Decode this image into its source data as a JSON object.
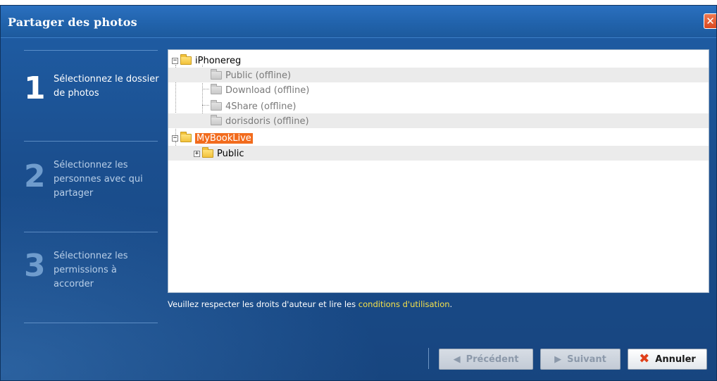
{
  "window": {
    "title": "Partager des photos"
  },
  "steps": [
    {
      "number": "1",
      "text": "Sélectionnez le dossier de photos",
      "active": true
    },
    {
      "number": "2",
      "text": "Sélectionnez les personnes avec qui partager",
      "active": false
    },
    {
      "number": "3",
      "text": "Sélectionnez les permissions à accorder",
      "active": false
    }
  ],
  "tree": {
    "items": [
      {
        "label": "iPhonereg",
        "expander": "−"
      },
      {
        "label": "Public (offline)"
      },
      {
        "label": "Download (offline)"
      },
      {
        "label": "4Share (offline)"
      },
      {
        "label": "dorisdoris (offline)"
      },
      {
        "label": "MyBookLive",
        "expander": "−",
        "selected": true
      },
      {
        "label": "Public",
        "expander": "+"
      }
    ]
  },
  "footer": {
    "notice_prefix": "Veuillez respecter les droits d'auteur et lire les ",
    "notice_link": "conditions d'utilisation",
    "notice_suffix": "."
  },
  "buttons": {
    "previous": "Précédent",
    "next": "Suivant",
    "cancel": "Annuler"
  },
  "colors": {
    "window_bg": "#1b4f8f",
    "selected_highlight": "#f26b1d",
    "link": "#f5e14a",
    "cancel_icon": "#e0401a"
  },
  "icons": {
    "close": "close-icon",
    "folder": "folder-icon",
    "cancel": "cancel-x-icon",
    "previous": "arrow-left-icon",
    "next": "arrow-right-icon"
  }
}
